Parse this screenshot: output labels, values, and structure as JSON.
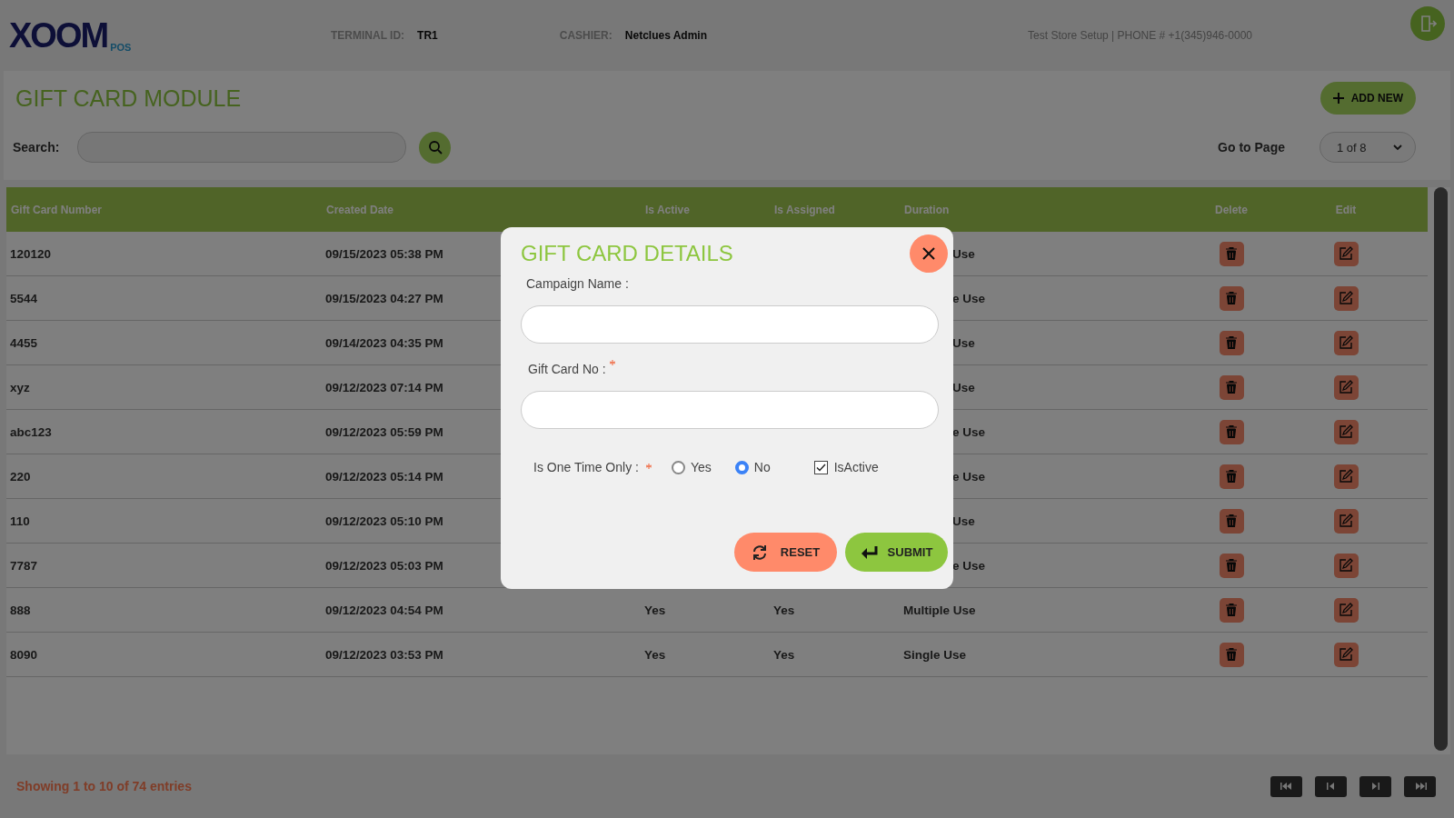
{
  "header": {
    "logo": {
      "main": "XOOM",
      "sub": "POS"
    },
    "terminal_label": "TERMINAL ID:",
    "terminal_id": "TR1",
    "cashier_label": "CASHIER:",
    "cashier": "Netclues Admin",
    "store": "Test Store Setup | PHONE # +1(345)946-0000"
  },
  "module": {
    "title": "GIFT CARD MODULE",
    "add_button": "ADD NEW",
    "search_label": "Search:",
    "go_to_page_label": "Go to Page",
    "page_select": "1 of 8"
  },
  "table": {
    "columns": [
      "Gift Card Number",
      "Created Date",
      "Is Active",
      "Is Assigned",
      "Duration",
      "Delete",
      "Edit"
    ],
    "rows": [
      {
        "number": "120120",
        "created": "09/15/2023 05:38 PM",
        "duration": "Use",
        "under_dialog": true
      },
      {
        "number": "5544",
        "created": "09/15/2023 04:27 PM",
        "duration": "e Use",
        "under_dialog": true
      },
      {
        "number": "4455",
        "created": "09/14/2023 04:35 PM",
        "duration": "Use",
        "under_dialog": true
      },
      {
        "number": "xyz",
        "created": "09/12/2023 07:14 PM",
        "duration": "Use",
        "under_dialog": true
      },
      {
        "number": "abc123",
        "created": "09/12/2023 05:59 PM",
        "duration": "e Use",
        "under_dialog": true
      },
      {
        "number": "220",
        "created": "09/12/2023 05:14 PM",
        "duration": "e Use",
        "under_dialog": true
      },
      {
        "number": "110",
        "created": "09/12/2023 05:10 PM",
        "duration": "Use",
        "under_dialog": true
      },
      {
        "number": "7787",
        "created": "09/12/2023 05:03 PM",
        "duration": "e Use",
        "under_dialog": true
      },
      {
        "number": "888",
        "created": "09/12/2023 04:54 PM",
        "is_active": "Yes",
        "is_assigned": "Yes",
        "duration": "Multiple Use"
      },
      {
        "number": "8090",
        "created": "09/12/2023 03:53 PM",
        "is_active": "Yes",
        "is_assigned": "Yes",
        "duration": "Single Use"
      }
    ]
  },
  "footer": {
    "entries": "Showing 1 to 10 of 74 entries"
  },
  "dialog": {
    "title": "GIFT CARD DETAILS",
    "campaign_label": "Campaign  Name :",
    "gift_card_label": "Gift Card No :",
    "gift_card_required": true,
    "one_time_label": "Is One Time Only  :",
    "one_time_required": true,
    "options": [
      {
        "label": "Yes",
        "selected": false
      },
      {
        "label": "No",
        "selected": true
      }
    ],
    "is_active": {
      "label": "IsActive",
      "checked": true
    },
    "reset": "RESET",
    "submit": "SUBMIT"
  }
}
